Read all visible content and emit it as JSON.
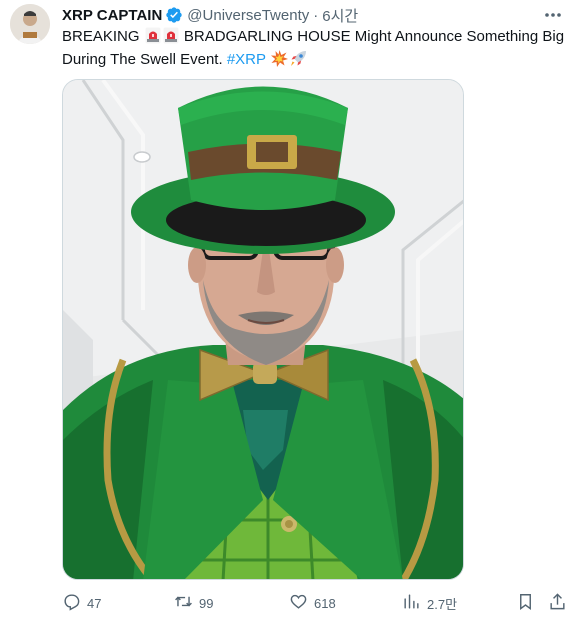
{
  "author": {
    "name": "XRP CAPTAIN",
    "handle": "@UniverseTwenty",
    "separator": "·",
    "time": "6시간"
  },
  "tweet": {
    "line1_a": "BREAKING",
    "line1_b": "BRADGARLING HOUSE Might Announce Something Big",
    "line2_a": "During The Swell Event.",
    "hashtag": "#XRP"
  },
  "icons": {
    "verified": "verified-badge-icon",
    "more": "more-icon",
    "siren": "siren-emoji",
    "collision": "collision-emoji",
    "rocket": "rocket-emoji",
    "reply": "reply-icon",
    "retweet": "retweet-icon",
    "like": "heart-icon",
    "views": "views-icon",
    "bookmark": "bookmark-icon",
    "share": "share-icon"
  },
  "stats": {
    "replies": "47",
    "retweets": "99",
    "likes": "618",
    "views": "2.7만"
  },
  "colors": {
    "text": "#0f1419",
    "secondary": "#536471",
    "link": "#1d9bf0",
    "verified": "#1d9bf0"
  }
}
